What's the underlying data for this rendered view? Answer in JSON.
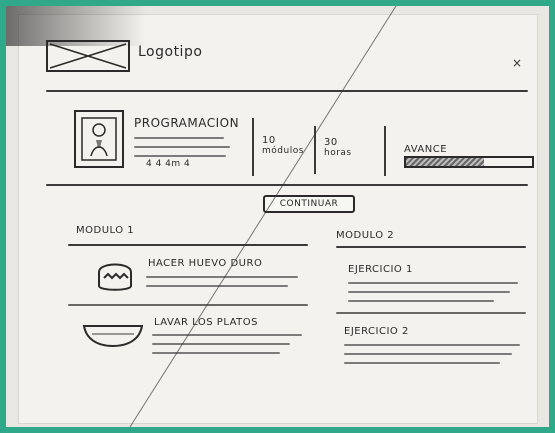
{
  "header": {
    "logo_text": "Logotipo",
    "close_symbol": "×"
  },
  "course": {
    "title": "PROGRAMACION",
    "meta_line": "4 4 4m 4",
    "stats": [
      {
        "value": "10",
        "label": "módulos"
      },
      {
        "value": "30",
        "label": "horas"
      }
    ],
    "progress": {
      "label": "AVANCE",
      "value": 0.62
    }
  },
  "primary_action": {
    "label": "CONTINUAR"
  },
  "modules": [
    {
      "title": "MODULO 1",
      "items": [
        {
          "title": "HACER HUEVO DURO",
          "icon": "basket-icon"
        },
        {
          "title": "LAVAR LOS PLATOS",
          "icon": "bowl-icon"
        }
      ]
    },
    {
      "title": "MODULO 2",
      "items": [
        {
          "title": "EJERCICIO 1"
        },
        {
          "title": "EJERCICIO 2"
        }
      ]
    }
  ],
  "colors": {
    "frame_border": "#2fa98a",
    "paper": "#f3f2ee",
    "ink": "#2a2a2a"
  }
}
